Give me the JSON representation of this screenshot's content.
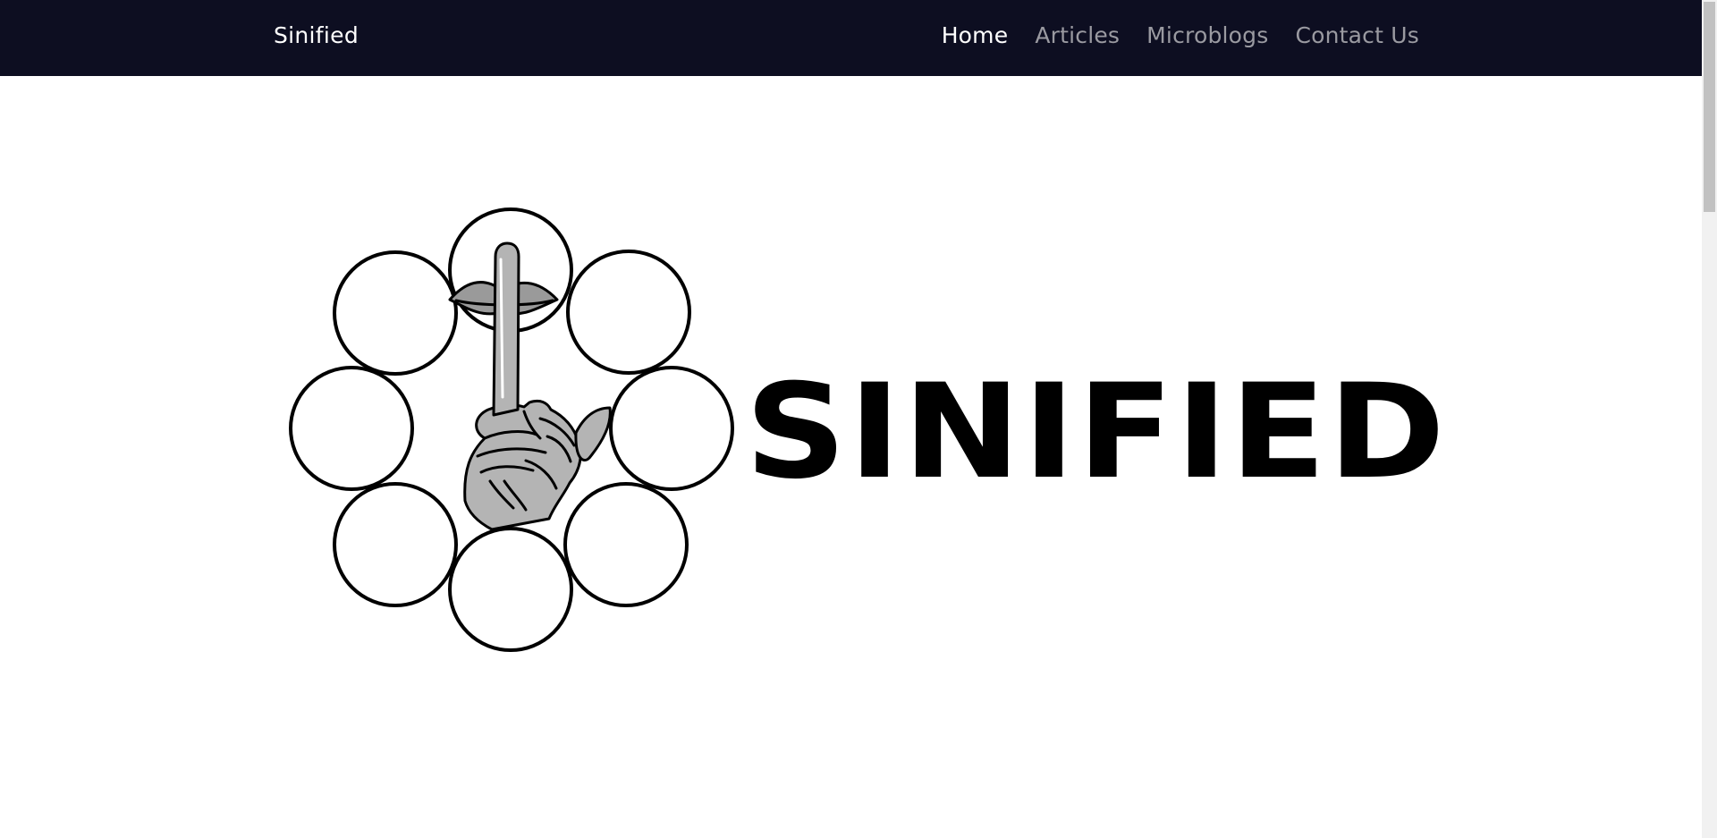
{
  "navbar": {
    "brand": "Sinified",
    "links": [
      {
        "label": "Home",
        "active": true
      },
      {
        "label": "Articles",
        "active": false
      },
      {
        "label": "Microblogs",
        "active": false
      },
      {
        "label": "Contact Us",
        "active": false
      }
    ],
    "background": "#0d0e21"
  },
  "hero": {
    "logo_icon": "shush-finger-circles-icon",
    "wordmark": "SINIFIED"
  }
}
